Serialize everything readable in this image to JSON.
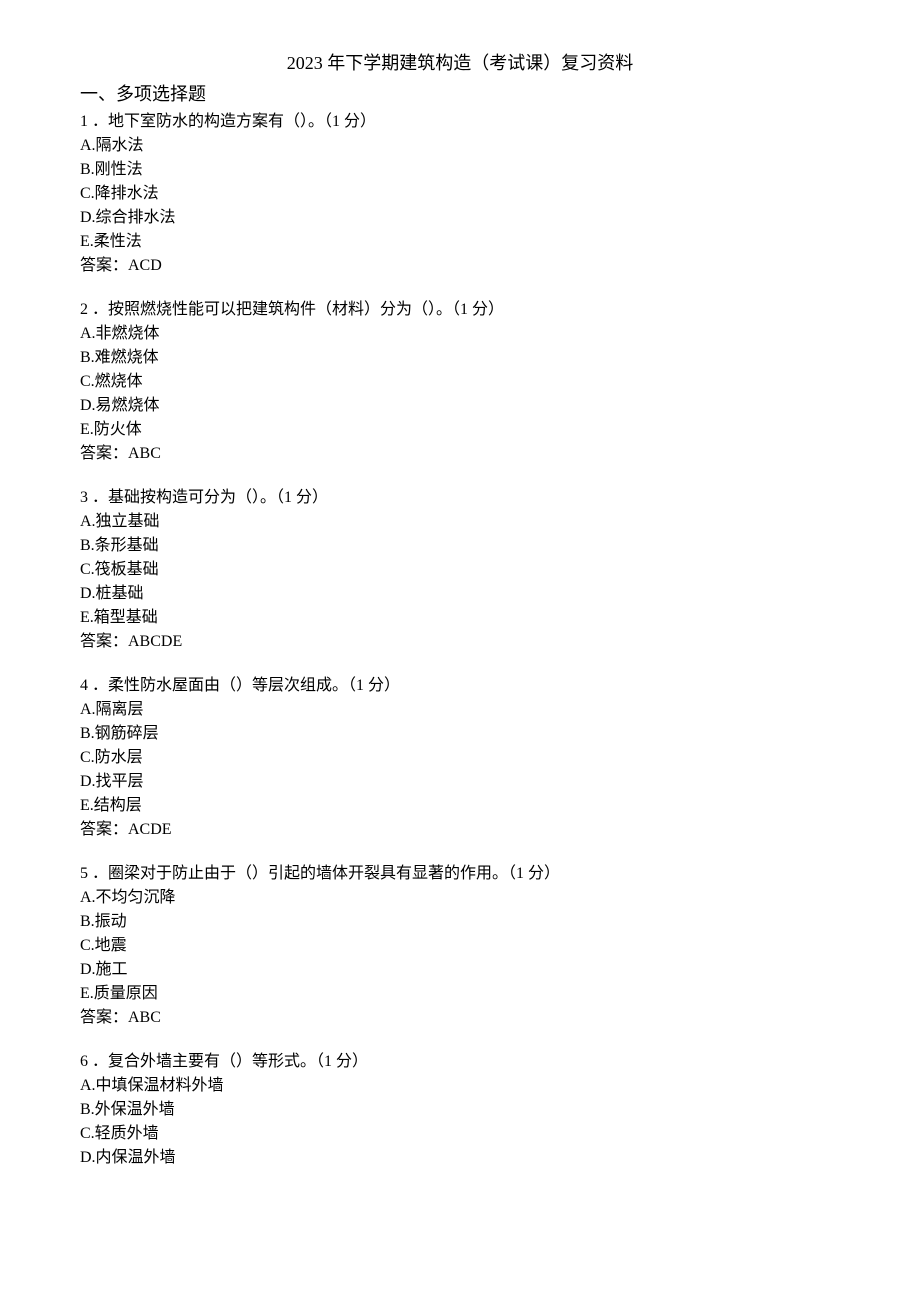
{
  "title": "2023 年下学期建筑构造（考试课）复习资料",
  "section_heading": "一、多项选择题",
  "questions": [
    {
      "num": "1",
      "text": "．地下室防水的构造方案有（）。（1 分）",
      "options": {
        "A": "A.隔水法",
        "B": "B.刚性法",
        "C": "C.降排水法",
        "D": "D.综合排水法",
        "E": "E.柔性法"
      },
      "answer": "答案：ACD"
    },
    {
      "num": "2",
      "text": "．按照燃烧性能可以把建筑构件（材料）分为（）。（1 分）",
      "options": {
        "A": "A.非燃烧体",
        "B": "B.难燃烧体",
        "C": "C.燃烧体",
        "D": "D.易燃烧体",
        "E": "E.防火体"
      },
      "answer": "答案：ABC"
    },
    {
      "num": "3",
      "text": "．基础按构造可分为（）。（1 分）",
      "options": {
        "A": "A.独立基础",
        "B": "B.条形基础",
        "C": "C.筏板基础",
        "D": "D.桩基础",
        "E": "E.箱型基础"
      },
      "answer": "答案：ABCDE"
    },
    {
      "num": "4",
      "text": "．柔性防水屋面由（）等层次组成。（1 分）",
      "options": {
        "A": "A.隔离层",
        "B": "B.钢筋碎层",
        "C": "C.防水层",
        "D": "D.找平层",
        "E": "E.结构层"
      },
      "answer": "答案：ACDE"
    },
    {
      "num": "5",
      "text": "．圈梁对于防止由于（）引起的墙体开裂具有显著的作用。（1 分）",
      "options": {
        "A": "A.不均匀沉降",
        "B": "B.振动",
        "C": "C.地震",
        "D": "D.施工",
        "E": "E.质量原因"
      },
      "answer": "答案：ABC"
    },
    {
      "num": "6",
      "text": "．复合外墙主要有（）等形式。（1 分）",
      "options": {
        "A": "A.中填保温材料外墙",
        "B": "B.外保温外墙",
        "C": "C.轻质外墙",
        "D": "D.内保温外墙"
      },
      "answer": ""
    }
  ]
}
